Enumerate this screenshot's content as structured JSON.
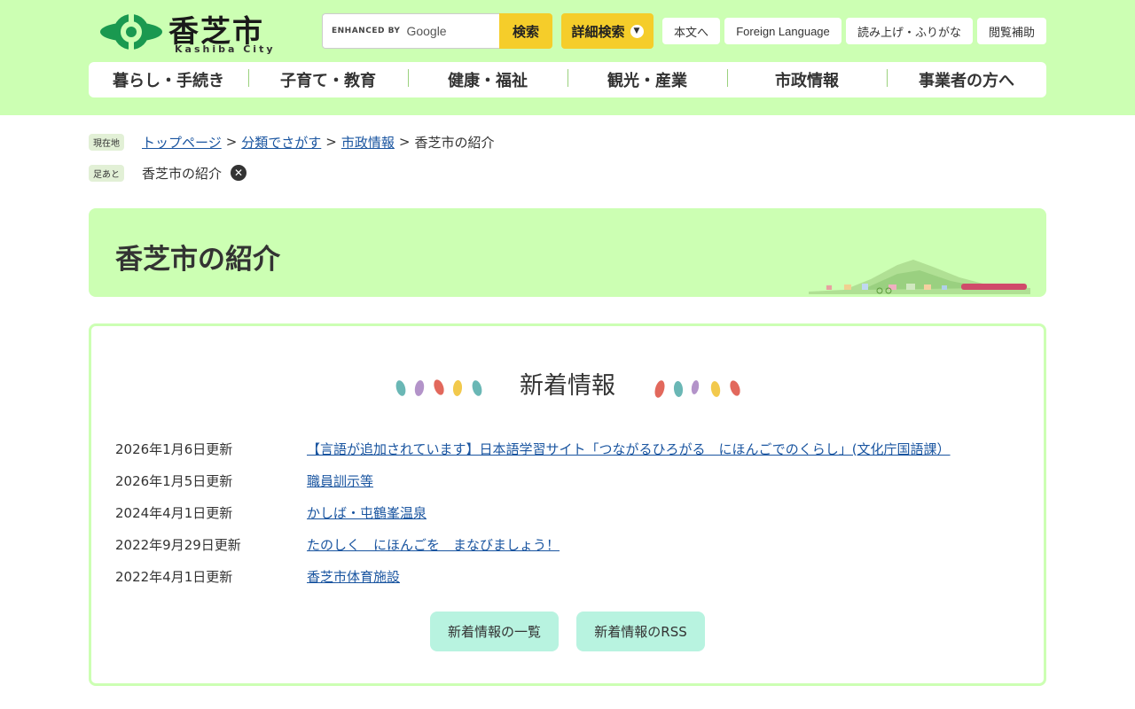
{
  "site": {
    "name": "香芝市",
    "name_roman": "Kashiba City"
  },
  "search": {
    "enhanced_label": "ENHANCED BY",
    "provider": "Google",
    "button_label": "検索",
    "advanced_label": "詳細検索"
  },
  "top_links": [
    "本文へ",
    "Foreign Language",
    "読み上げ・ふりがな",
    "閲覧補助"
  ],
  "nav": [
    "暮らし・手続き",
    "子育て・教育",
    "健康・福祉",
    "観光・産業",
    "市政情報",
    "事業者の方へ"
  ],
  "breadcrumb": {
    "label": "現在地",
    "items": [
      "トップページ",
      "分類でさがす",
      "市政情報"
    ],
    "current": "香芝市の紹介",
    "separator": ">"
  },
  "footprint": {
    "label": "足あと",
    "items": [
      "香芝市の紹介"
    ]
  },
  "page_title": "香芝市の紹介",
  "news": {
    "heading": "新着情報",
    "items": [
      {
        "date": "2026年1月6日更新",
        "title": "【言語が追加されています】日本語学習サイト「つながるひろがる　にほんごでのくらし」(文化庁国語課）"
      },
      {
        "date": "2026年1月5日更新",
        "title": "職員訓示等"
      },
      {
        "date": "2024年4月1日更新",
        "title": "かしば・屯鶴峯温泉"
      },
      {
        "date": "2022年9月29日更新",
        "title": "たのしく　にほんごを　まなびましょう！"
      },
      {
        "date": "2022年4月1日更新",
        "title": "香芝市体育施設"
      }
    ],
    "list_button": "新着情報の一覧",
    "rss_button": "新着情報のRSS"
  },
  "colors": {
    "header_bg": "#ccffb3",
    "accent_yellow": "#f5cd2a",
    "link": "#1a55a0",
    "button_mint": "#b8f3e0",
    "logo_green": "#1a9950"
  }
}
